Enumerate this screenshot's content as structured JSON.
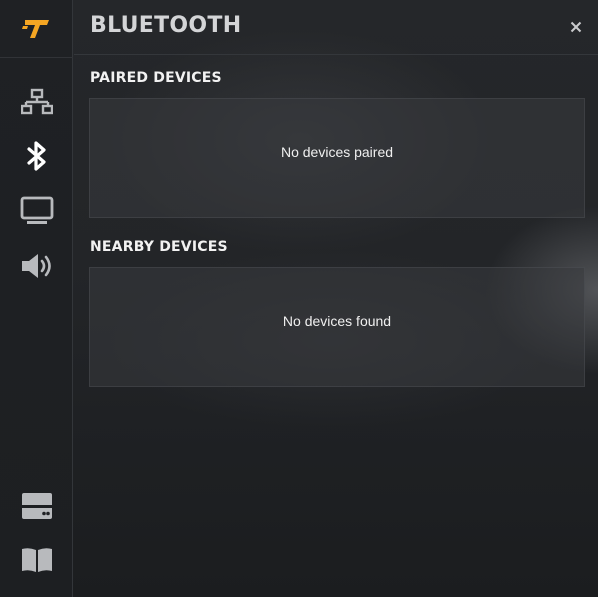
{
  "app": {
    "logo_text": "T"
  },
  "header": {
    "title": "BLUETOOTH",
    "close_label": "×"
  },
  "sidebar": {
    "items": [
      {
        "name": "network",
        "icon": "network-icon"
      },
      {
        "name": "bluetooth",
        "icon": "bluetooth-icon",
        "active": true
      },
      {
        "name": "display",
        "icon": "monitor-icon"
      },
      {
        "name": "sound",
        "icon": "speaker-icon"
      },
      {
        "name": "storage",
        "icon": "storage-icon"
      },
      {
        "name": "manual",
        "icon": "book-icon"
      }
    ]
  },
  "sections": {
    "paired": {
      "title": "PAIRED DEVICES",
      "empty_text": "No devices paired"
    },
    "nearby": {
      "title": "NEARBY DEVICES",
      "empty_text": "No devices found"
    }
  },
  "colors": {
    "brand_accent": "#f5a623",
    "icon_default": "#b8babd",
    "icon_active": "#ffffff",
    "background": "#1f2124"
  }
}
